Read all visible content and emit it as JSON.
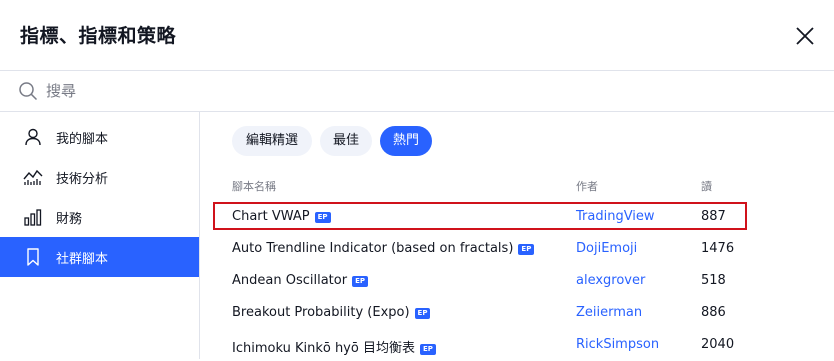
{
  "dialog": {
    "title": "指標、指標和策略"
  },
  "search": {
    "placeholder": "搜尋",
    "value": ""
  },
  "sidebar": {
    "items": [
      {
        "label": "我的腳本",
        "icon": "user-icon"
      },
      {
        "label": "技術分析",
        "icon": "chart-line-icon"
      },
      {
        "label": "財務",
        "icon": "bar-chart-icon"
      },
      {
        "label": "社群腳本",
        "icon": "bookmark-icon",
        "active": true
      }
    ]
  },
  "tabs": [
    {
      "label": "編輯精選"
    },
    {
      "label": "最佳"
    },
    {
      "label": "熱門",
      "active": true
    }
  ],
  "table": {
    "columns": [
      "腳本名稱",
      "作者",
      "讀"
    ],
    "badge": "EP",
    "rows": [
      {
        "name": "Chart VWAP",
        "author": "TradingView",
        "reads": "887"
      },
      {
        "name": "Auto Trendline Indicator (based on fractals)",
        "author": "DojiEmoji",
        "reads": "1476"
      },
      {
        "name": "Andean Oscillator",
        "author": "alexgrover",
        "reads": "518"
      },
      {
        "name": "Breakout Probability (Expo)",
        "author": "Zeiierman",
        "reads": "886"
      },
      {
        "name": "Ichimoku Kinkō hyō 目均衡表",
        "author": "RickSimpson",
        "reads": "2040"
      }
    ]
  },
  "colors": {
    "accent": "#2962ff",
    "highlight_border": "#d0121b",
    "tab_bg": "#f0f3fa",
    "muted_text": "#787b86"
  }
}
